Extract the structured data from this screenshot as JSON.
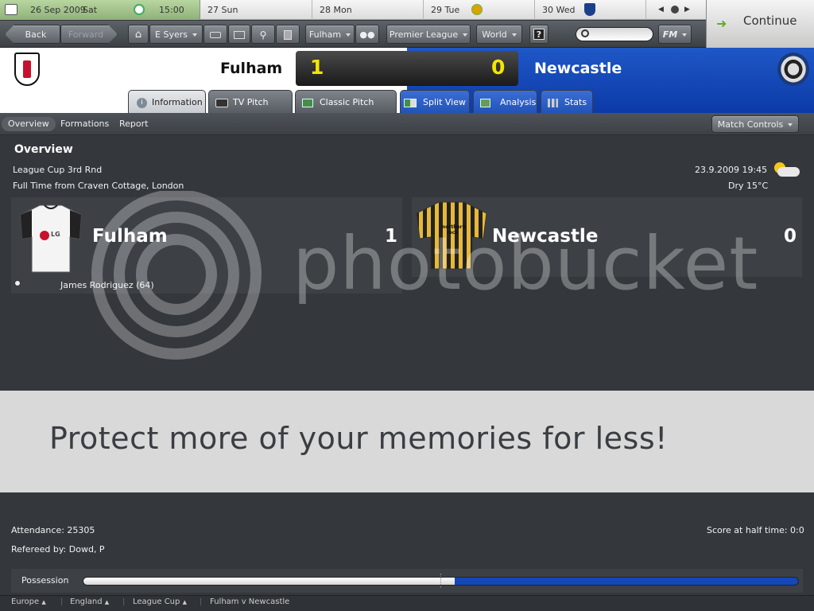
{
  "calendar": {
    "today": {
      "date": "26 Sep 2009",
      "weekday": "Sat",
      "time": "15:00"
    },
    "days": [
      {
        "num": "27",
        "name": "Sun"
      },
      {
        "num": "28",
        "name": "Mon"
      },
      {
        "num": "29",
        "name": "Tue"
      },
      {
        "num": "30",
        "name": "Wed"
      }
    ]
  },
  "toolbar": {
    "back": "Back",
    "forward": "Forward",
    "manager": "E Syers",
    "club": "Fulham",
    "competition": "Premier League",
    "world": "World",
    "help": "?",
    "search_placeholder": "",
    "fm": "FM"
  },
  "continue_label": "Continue",
  "match": {
    "home_team": "Fulham",
    "away_team": "Newcastle",
    "home_score": "1",
    "away_score": "0"
  },
  "tabs": [
    {
      "label": "Information"
    },
    {
      "label": "TV Pitch View"
    },
    {
      "label": "Classic Pitch View"
    },
    {
      "label": "Split View"
    },
    {
      "label": "Analysis"
    },
    {
      "label": "Stats"
    }
  ],
  "subnav": {
    "items": [
      "Overview",
      "Formations",
      "Report"
    ],
    "match_controls": "Match Controls"
  },
  "overview": {
    "title": "Overview",
    "competition": "League Cup 3rd Rnd",
    "venue": "Full Time from Craven Cottage, London",
    "datetime": "23.9.2009 19:45",
    "weather": "Dry 15°C",
    "home_name": "Fulham",
    "home_score": "1",
    "away_name": "Newcastle",
    "away_score": "0",
    "home_scorer": "James Rodriguez (64)",
    "home_shirt_sponsor": "LG",
    "away_shirt_sponsor": "northern rock"
  },
  "watermark": {
    "brand": "photobucket",
    "banner": "Protect more of your memories for less!"
  },
  "stats": {
    "attendance": "Attendance: 25305",
    "referee": "Refereed by: Dowd, P",
    "half_time": "Score at half time: 0:0",
    "possession_label": "Possession",
    "home_possession_fraction": 0.52
  },
  "breadcrumbs": [
    "Europe",
    "England",
    "League Cup",
    "Fulham v Newcastle"
  ],
  "colors": {
    "away_blue": "#1447b8",
    "score_yellow": "#f2e600",
    "possession_home": "#e8e8e8",
    "possession_away": "#1447b8"
  }
}
